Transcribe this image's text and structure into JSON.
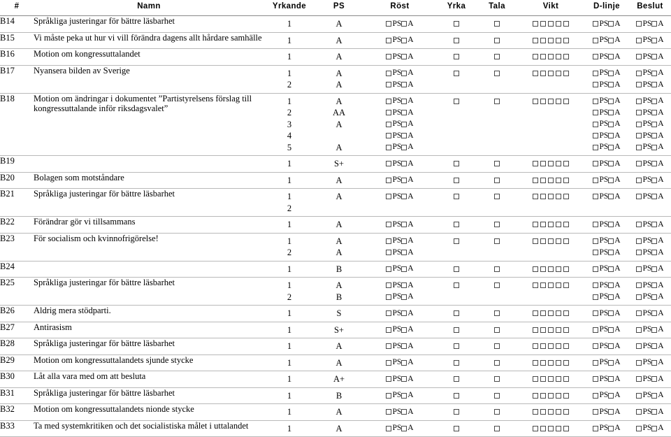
{
  "table": {
    "columns": [
      {
        "key": "id",
        "label": "#"
      },
      {
        "key": "namn",
        "label": "Namn"
      },
      {
        "key": "yrkande",
        "label": "Yrkande"
      },
      {
        "key": "ps",
        "label": "PS"
      },
      {
        "key": "rost",
        "label": "Röst"
      },
      {
        "key": "yrka",
        "label": "Yrka"
      },
      {
        "key": "tala",
        "label": "Tala"
      },
      {
        "key": "vikt",
        "label": "Vikt"
      },
      {
        "key": "dlinje",
        "label": "D-linje"
      },
      {
        "key": "beslut",
        "label": "Beslut"
      }
    ],
    "checkbox_labels": {
      "ps": "PS",
      "a": "A"
    },
    "vikt_checkbox_count": 5,
    "rows": [
      {
        "id": "B14",
        "namn": "Språkliga justeringar för bättre läsbarhet",
        "sub": [
          {
            "yrkande": "1",
            "ps": "A",
            "checks": true
          }
        ]
      },
      {
        "id": "B15",
        "namn": "Vi måste peka ut hur vi vill förändra dagens allt hårdare samhälle",
        "sub": [
          {
            "yrkande": "1",
            "ps": "A",
            "checks": true
          }
        ]
      },
      {
        "id": "B16",
        "namn": "Motion om kongressuttalandet",
        "sub": [
          {
            "yrkande": "1",
            "ps": "A",
            "checks": true
          }
        ]
      },
      {
        "id": "B17",
        "namn": "Nyansera bilden av Sverige",
        "sub": [
          {
            "yrkande": "1",
            "ps": "A",
            "checks": true
          },
          {
            "yrkande": "2",
            "ps": "A",
            "checks": false
          }
        ]
      },
      {
        "id": "B18",
        "namn": "Motion om ändringar i dokumentet ”Partistyrelsens förslag till kongressuttalande inför riksdagsvalet”",
        "sub": [
          {
            "yrkande": "1",
            "ps": "A",
            "checks": true
          },
          {
            "yrkande": "2",
            "ps": "AA",
            "checks": false
          },
          {
            "yrkande": "3",
            "ps": "A",
            "checks": false
          },
          {
            "yrkande": "4",
            "ps": "",
            "checks": false
          },
          {
            "yrkande": "5",
            "ps": "A",
            "checks": false
          }
        ]
      },
      {
        "id": "B19",
        "namn": "",
        "sub": [
          {
            "yrkande": "1",
            "ps": "S+",
            "checks": true
          }
        ]
      },
      {
        "id": "B20",
        "namn": "Bolagen som motståndare",
        "sub": [
          {
            "yrkande": "1",
            "ps": "A",
            "checks": true
          }
        ]
      },
      {
        "id": "B21",
        "namn": "Språkliga justeringar för bättre läsbarhet",
        "sub": [
          {
            "yrkande": "1",
            "ps": "A",
            "checks": true
          },
          {
            "yrkande": "2",
            "ps": "",
            "checks": false,
            "no_boxes": true
          }
        ]
      },
      {
        "id": "B22",
        "namn": "Förändrar gör vi tillsammans",
        "sub": [
          {
            "yrkande": "1",
            "ps": "A",
            "checks": true
          }
        ]
      },
      {
        "id": "B23",
        "namn": "För socialism och kvinnofrigörelse!",
        "sub": [
          {
            "yrkande": "1",
            "ps": "A",
            "checks": true
          },
          {
            "yrkande": "2",
            "ps": "A",
            "checks": false
          }
        ]
      },
      {
        "id": "B24",
        "namn": "",
        "sub": [
          {
            "yrkande": "1",
            "ps": "B",
            "checks": true
          }
        ]
      },
      {
        "id": "B25",
        "namn": "Språkliga justeringar för bättre läsbarhet",
        "sub": [
          {
            "yrkande": "1",
            "ps": "A",
            "checks": true
          },
          {
            "yrkande": "2",
            "ps": "B",
            "checks": false
          }
        ]
      },
      {
        "id": "B26",
        "namn": "Aldrig mera stödparti.",
        "sub": [
          {
            "yrkande": "1",
            "ps": "S",
            "checks": true
          }
        ]
      },
      {
        "id": "B27",
        "namn": "Antirasism",
        "sub": [
          {
            "yrkande": "1",
            "ps": "S+",
            "checks": true
          }
        ]
      },
      {
        "id": "B28",
        "namn": "Språkliga justeringar för bättre läsbarhet",
        "sub": [
          {
            "yrkande": "1",
            "ps": "A",
            "checks": true
          }
        ]
      },
      {
        "id": "B29",
        "namn": "Motion om kongressuttalandets sjunde stycke",
        "sub": [
          {
            "yrkande": "1",
            "ps": "A",
            "checks": true
          }
        ]
      },
      {
        "id": "B30",
        "namn": "Låt alla vara med om att besluta",
        "sub": [
          {
            "yrkande": "1",
            "ps": "A+",
            "checks": true
          }
        ]
      },
      {
        "id": "B31",
        "namn": "Språkliga justeringar för bättre läsbarhet",
        "sub": [
          {
            "yrkande": "1",
            "ps": "B",
            "checks": true
          }
        ]
      },
      {
        "id": "B32",
        "namn": "Motion om kongressuttalandets nionde stycke",
        "sub": [
          {
            "yrkande": "1",
            "ps": "A",
            "checks": true
          }
        ]
      },
      {
        "id": "B33",
        "namn": "Ta med systemkritiken och det socialistiska målet i uttalandet",
        "sub": [
          {
            "yrkande": "1",
            "ps": "A",
            "checks": true
          }
        ]
      }
    ]
  },
  "colors": {
    "text": "#000000",
    "rule": "#b9b9b9",
    "header_rule": "#8a8a8a",
    "checkbox_border": "#4a4a4a",
    "background": "#ffffff"
  }
}
